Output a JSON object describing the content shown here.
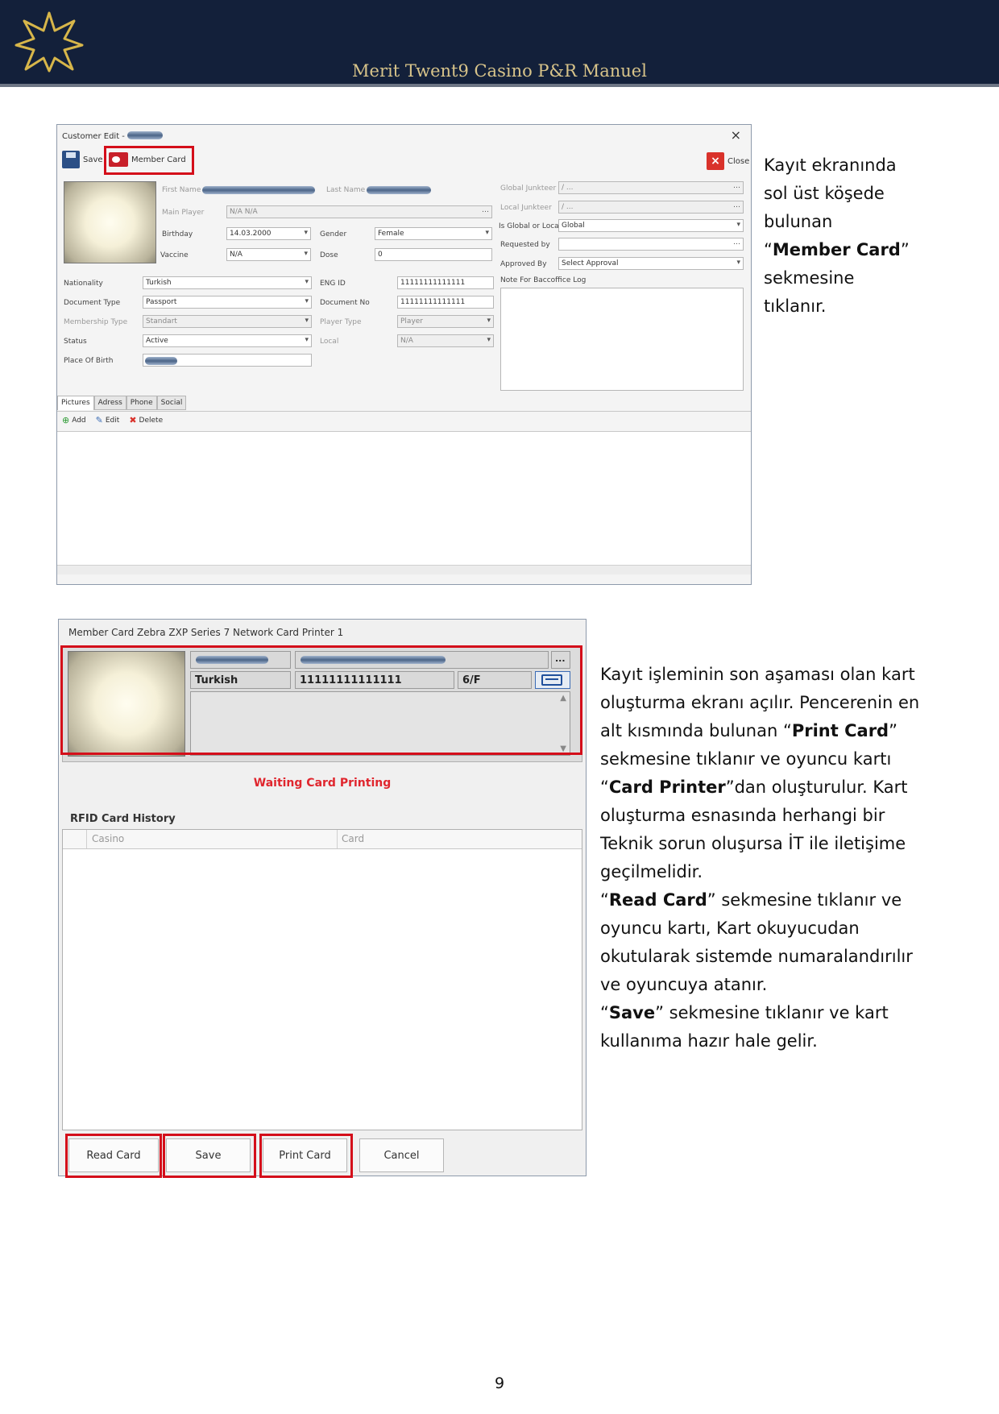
{
  "header": {
    "title": "Merit Twent9 Casino P&R Manuel"
  },
  "customer_edit": {
    "title": "Customer Edit -",
    "save": "Save",
    "member_card": "Member Card",
    "close": "Close",
    "labels": {
      "first_name": "First Name",
      "last_name": "Last Name",
      "main_player": "Main Player",
      "birthday": "Birthday",
      "gender": "Gender",
      "vaccine": "Vaccine",
      "dose": "Dose",
      "nationality": "Nationality",
      "eng_id": "ENG ID",
      "document_type": "Document Type",
      "document_no": "Document No",
      "membership_type": "Membership Type",
      "player_type": "Player Type",
      "status": "Status",
      "local": "Local",
      "place_of_birth": "Place Of Birth",
      "global_junkteer": "Global Junkteer",
      "local_junkteer": "Local Junkteer",
      "is_global_or_local": "Is Global or Local",
      "requested_by": "Requested by",
      "approved_by": "Approved By",
      "note": "Note For Baccoffice Log"
    },
    "values": {
      "main_player": "N/A N/A",
      "birthday": "14.03.2000",
      "gender": "Female",
      "vaccine": "N/A",
      "dose": "0",
      "nationality": "Turkish",
      "eng_id": "11111111111111",
      "document_type": "Passport",
      "document_no": "11111111111111",
      "membership_type": "Standart",
      "player_type": "Player",
      "status": "Active",
      "local": "N/A",
      "global_junkteer": "/ ...",
      "local_junkteer": "/ ...",
      "is_global_or_local": "Global",
      "approved_by": "Select Approval"
    },
    "tabs": [
      "Pictures",
      "Adress",
      "Phone",
      "Social"
    ],
    "tools": {
      "add": "Add",
      "edit": "Edit",
      "delete": "Delete"
    }
  },
  "paragraph1": {
    "l1": "Kayıt ekranında",
    "l2": "sol üst köşede",
    "l3": "bulunan",
    "q_open": "“",
    "bold": "Member Card",
    "q_close": "”",
    "l5": "sekmesine",
    "l6": "tıklanır."
  },
  "member_card_window": {
    "title": "Member Card Zebra ZXP Series 7 Network Card Printer 1",
    "nationality": "Turkish",
    "card_number": "11111111111111",
    "floor": "6/F",
    "more_button": "...",
    "waiting": "Waiting Card Printing",
    "rfid_history": "RFID Card History",
    "columns": [
      "Casino",
      "Card"
    ],
    "buttons": {
      "read_card": "Read Card",
      "save": "Save",
      "print_card": "Print Card",
      "cancel": "Cancel"
    }
  },
  "paragraph2": {
    "s1": "Kayıt işleminin son aşaması olan kart oluşturma ekranı açılır. Pencerenin en alt kısmında bulunan “",
    "b1": "Print Card",
    "s2": "” sekmesine tıklanır ve oyuncu kartı “",
    "b2": "Card Printer",
    "s3": "”dan oluşturulur. Kart oluşturma esnasında herhangi bir Teknik sorun oluşursa İT ile iletişime geçilmelidir.",
    "s4": "“",
    "b3": "Read Card",
    "s5": "” sekmesine tıklanır ve oyuncu kartı, Kart okuyucudan okutularak sistemde numaralandırılır ve oyuncuya atanır.",
    "s6": "“",
    "b4": "Save",
    "s7": "” sekmesine tıklanır ve kart kullanıma hazır hale gelir."
  },
  "footer": {
    "page_number": "9"
  }
}
